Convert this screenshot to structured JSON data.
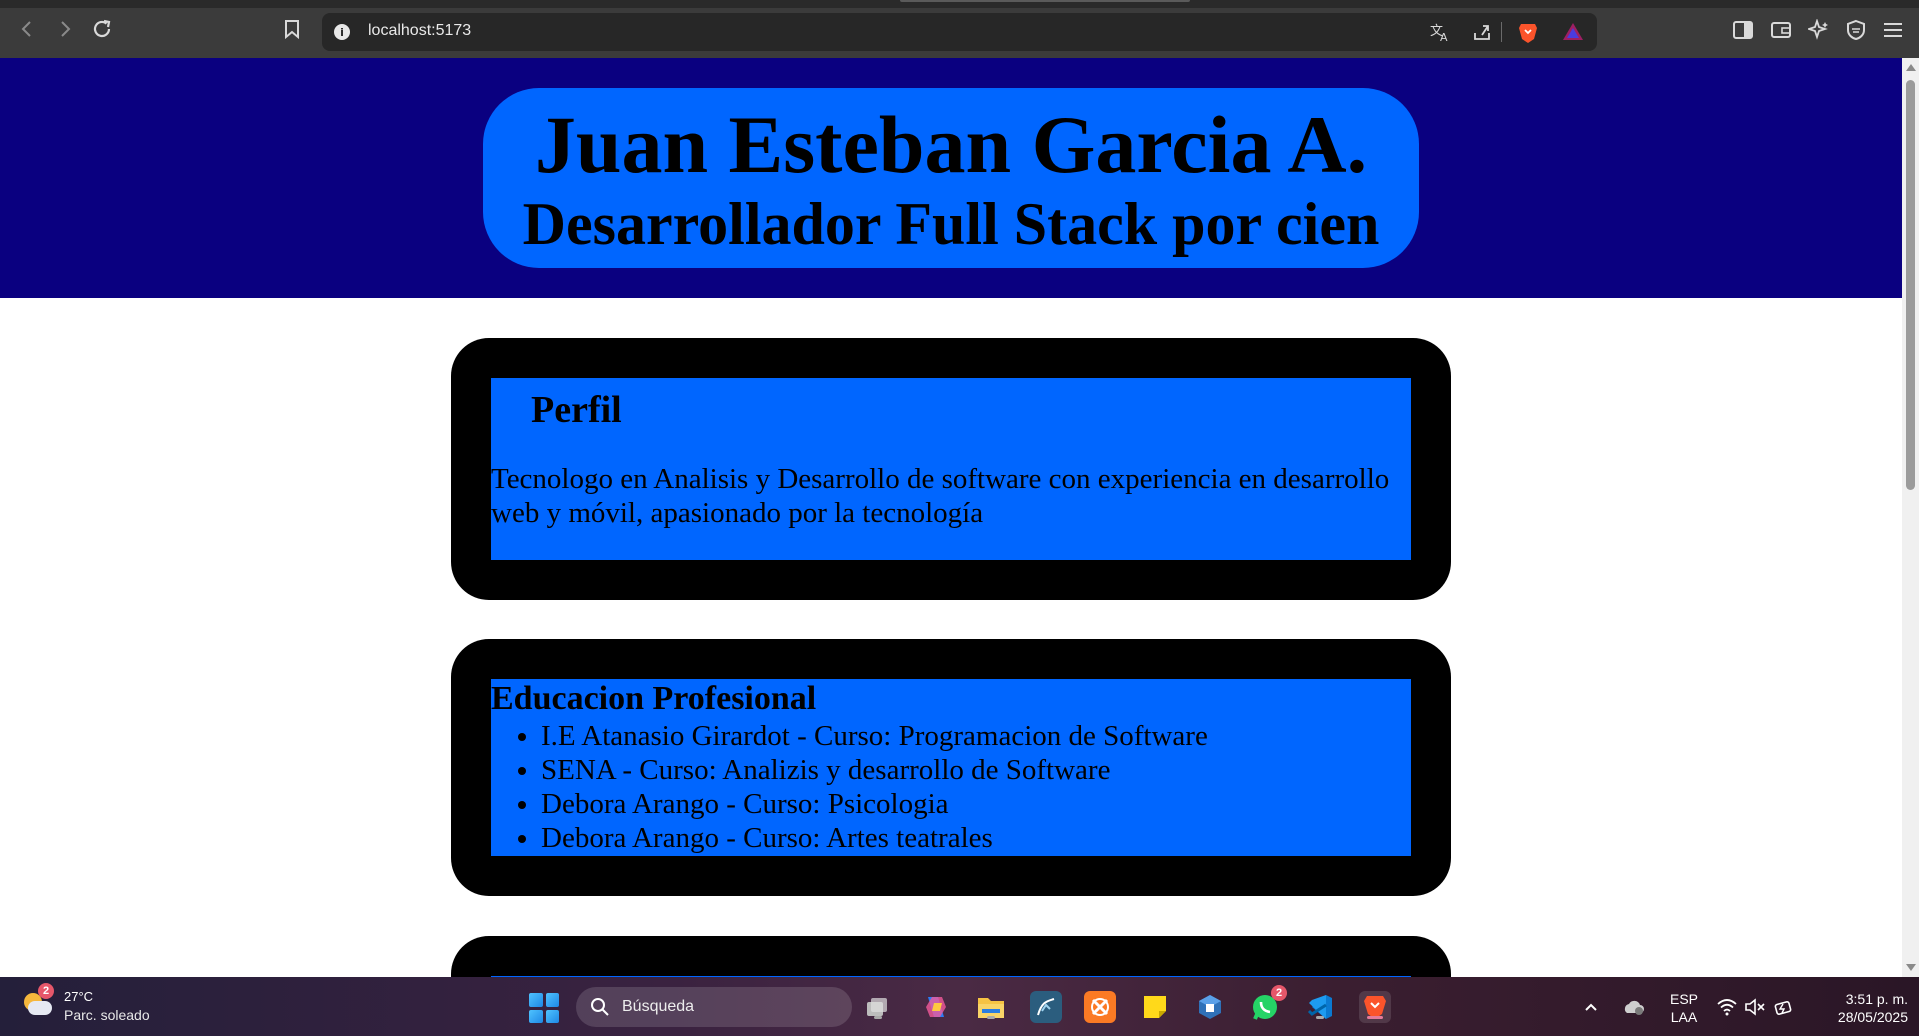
{
  "browser": {
    "url": "localhost:5173",
    "icons": {
      "back": "back-arrow-icon",
      "forward": "forward-arrow-icon",
      "reload": "reload-icon",
      "bookmark": "bookmark-icon",
      "site_info": "info-icon",
      "translate": "translate-icon",
      "share": "share-icon",
      "brave": "brave-shield-icon",
      "rewards": "brave-rewards-icon",
      "sidebar": "sidebar-icon",
      "wallet": "wallet-icon",
      "leo": "leo-ai-icon",
      "vpn": "vpn-icon",
      "menu": "hamburger-menu-icon"
    }
  },
  "page": {
    "header": {
      "name": "Juan Esteban Garcia A.",
      "role": "Desarrollador Full Stack por cien"
    },
    "perfil": {
      "title": "Perfil",
      "text": "Tecnologo en Analisis y Desarrollo de software con experiencia en desarrollo web y móvil, apasionado por la tecnología"
    },
    "educacion": {
      "title": "Educacion Profesional",
      "items": [
        "I.E Atanasio Girardot - Curso: Programacion de Software",
        "SENA - Curso: Analizis y desarrollo de Software",
        "Debora Arango - Curso: Psicologia",
        "Debora Arango - Curso: Artes teatrales"
      ]
    },
    "colors": {
      "header_bg": "#0a0080",
      "pill_bg": "#0066ff",
      "card_bg": "#000000",
      "card_inner_bg": "#0066ff"
    }
  },
  "taskbar": {
    "weather": {
      "badge": "2",
      "temp": "27°C",
      "desc": "Parc. soleado"
    },
    "search_label": "Búsqueda",
    "whatsapp_badge": "2",
    "apps": [
      "task-view-icon",
      "copilot-icon",
      "file-explorer-icon",
      "mysql-workbench-icon",
      "xampp-icon",
      "sticky-notes-icon",
      "virtualbox-icon",
      "whatsapp-icon",
      "vscode-icon",
      "brave-icon"
    ],
    "language": "ESP",
    "layout": "LAA",
    "time": "3:51 p. m.",
    "date": "28/05/2025"
  }
}
